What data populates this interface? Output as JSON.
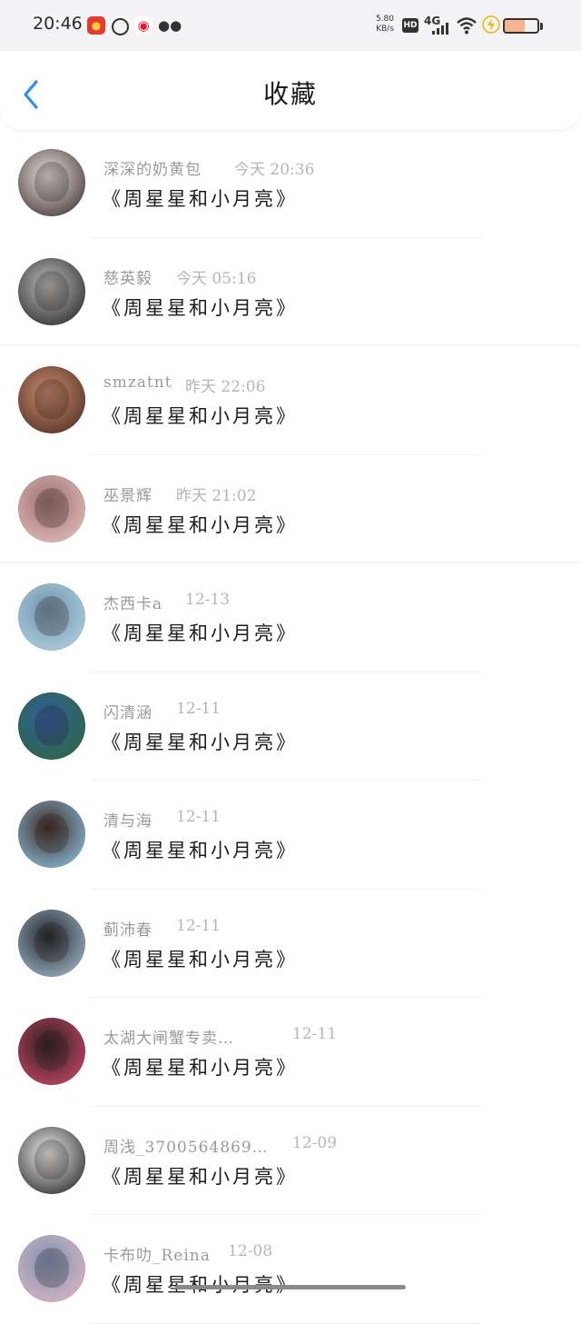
{
  "status_bar": {
    "time": "20:46",
    "net_speed_value": "5.80",
    "net_speed_unit": "KB/s",
    "hd": "HD",
    "network": "4G",
    "battery_level": 0.62,
    "icons": [
      "app-badge-icon",
      "sync-icon",
      "weibo-icon",
      "wechat-icon",
      "signal-icon",
      "wifi-icon",
      "charging-icon",
      "battery-icon"
    ]
  },
  "header": {
    "title": "收藏"
  },
  "items": [
    {
      "username": "深深的奶黄包",
      "time": "今天 20:36",
      "title": "《周星星和小月亮》",
      "colors": [
        "#3b2b2b",
        "#e9e3de"
      ]
    },
    {
      "username": "慈英毅",
      "time": "今天 05:16",
      "title": "《周星星和小月亮》",
      "colors": [
        "#222222",
        "#bdbdbd"
      ]
    },
    {
      "username": "smzatnt",
      "time": "昨天 22:06",
      "title": "《周星星和小月亮》",
      "colors": [
        "#4a2c22",
        "#c98b6b"
      ]
    },
    {
      "username": "巫景辉",
      "time": "昨天 21:02",
      "title": "《周星星和小月亮》",
      "colors": [
        "#e6c3c1",
        "#9d6f6c"
      ]
    },
    {
      "username": "杰西卡a",
      "time": "12-13",
      "title": "《周星星和小月亮》",
      "colors": [
        "#b7d4e6",
        "#6f93aa"
      ]
    },
    {
      "username": "闪清涵",
      "time": "12-11",
      "title": "《周星星和小月亮》",
      "colors": [
        "#2f6a2f",
        "#2e5ea8"
      ]
    },
    {
      "username": "清与海",
      "time": "12-11",
      "title": "《周星星和小月亮》",
      "colors": [
        "#8fc7e8",
        "#3e2a22"
      ]
    },
    {
      "username": "蓟沛春",
      "time": "12-11",
      "title": "《周星星和小月亮》",
      "colors": [
        "#a8c0d2",
        "#1f2428"
      ]
    },
    {
      "username": "太湖大闸蟹专卖…",
      "time": "12-11",
      "title": "《周星星和小月亮》",
      "colors": [
        "#d24a6a",
        "#2a1e1e"
      ]
    },
    {
      "username": "周浅_3700564869…",
      "time": "12-09",
      "title": "《周星星和小月亮》",
      "colors": [
        "#1e1e1e",
        "#f1f1f1"
      ]
    },
    {
      "username": "卡布叻_Reina",
      "time": "12-08",
      "title": "《周星星和小月亮》",
      "colors": [
        "#e5b9c2",
        "#7a93b6"
      ]
    }
  ],
  "accent_color": "#2f8ff0"
}
